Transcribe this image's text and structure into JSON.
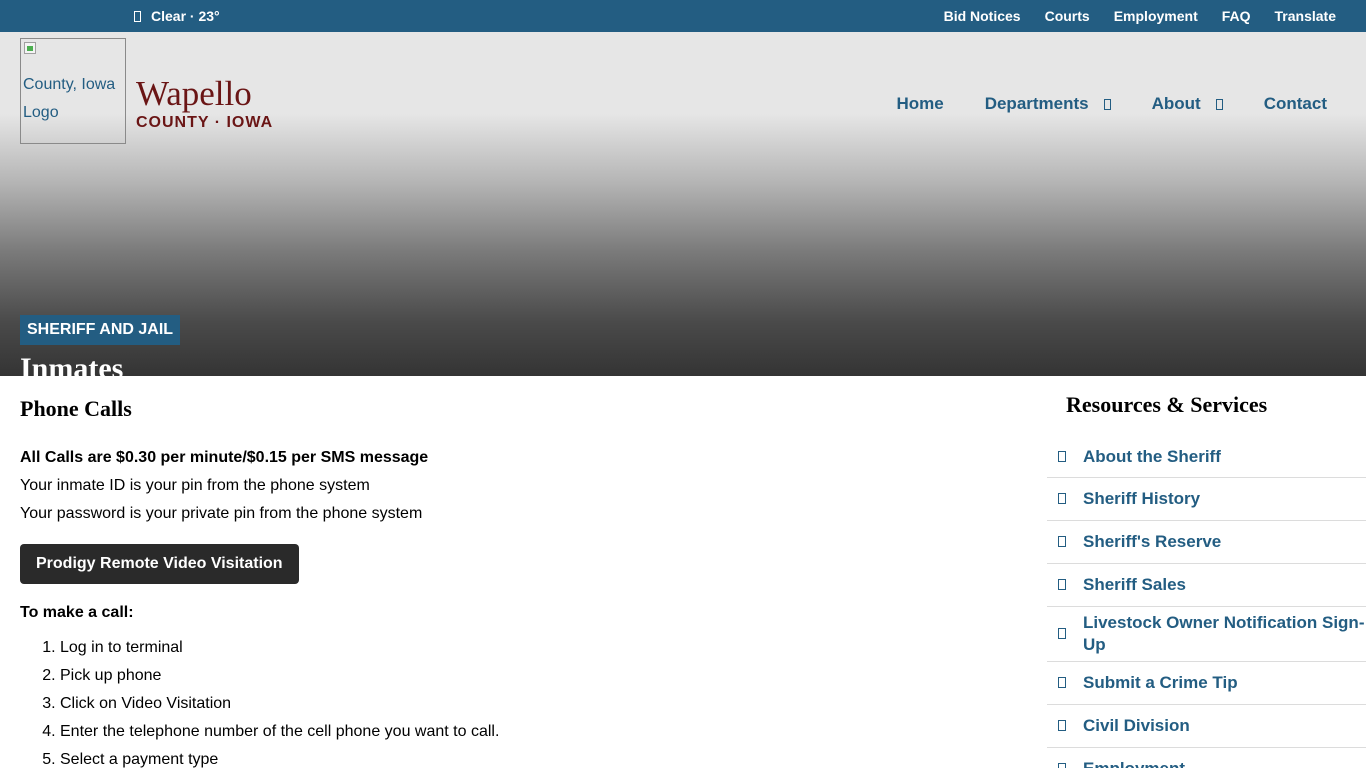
{
  "topbar": {
    "weather": "Clear · 23°",
    "links": [
      "Bid Notices",
      "Courts",
      "Employment",
      "FAQ",
      "Translate"
    ]
  },
  "logo": {
    "alt": "County, Iowa Logo"
  },
  "brand": {
    "name": "Wapello",
    "sub": "COUNTY · IOWA"
  },
  "nav": {
    "home": "Home",
    "departments": "Departments",
    "about": "About",
    "contact": "Contact"
  },
  "hero": {
    "badge": "SHERIFF AND JAIL",
    "title": "Inmates"
  },
  "main": {
    "heading": "Phone Calls",
    "rate": "All Calls are $0.30 per minute/$0.15 per SMS message",
    "id_note": "Your inmate ID is your pin from the phone system",
    "pw_note": "Your password is your private pin from the phone system",
    "button": "Prodigy Remote Video Visitation",
    "subhead": "To make a call:",
    "steps": [
      "Log in to terminal",
      "Pick up phone",
      "Click on Video Visitation",
      "Enter the telephone number of the cell phone you want to call.",
      "Select a payment type"
    ]
  },
  "sidebar": {
    "title": "Resources & Services",
    "items": [
      "About the Sheriff",
      "Sheriff History",
      "Sheriff's Reserve",
      "Sheriff Sales",
      "Livestock Owner Notification Sign-Up",
      "Submit a Crime Tip",
      "Civil Division",
      "Employment"
    ]
  },
  "colors": {
    "brand_blue": "#235d82",
    "brand_maroon": "#6a1515",
    "button_dark": "#2a2a2a"
  }
}
